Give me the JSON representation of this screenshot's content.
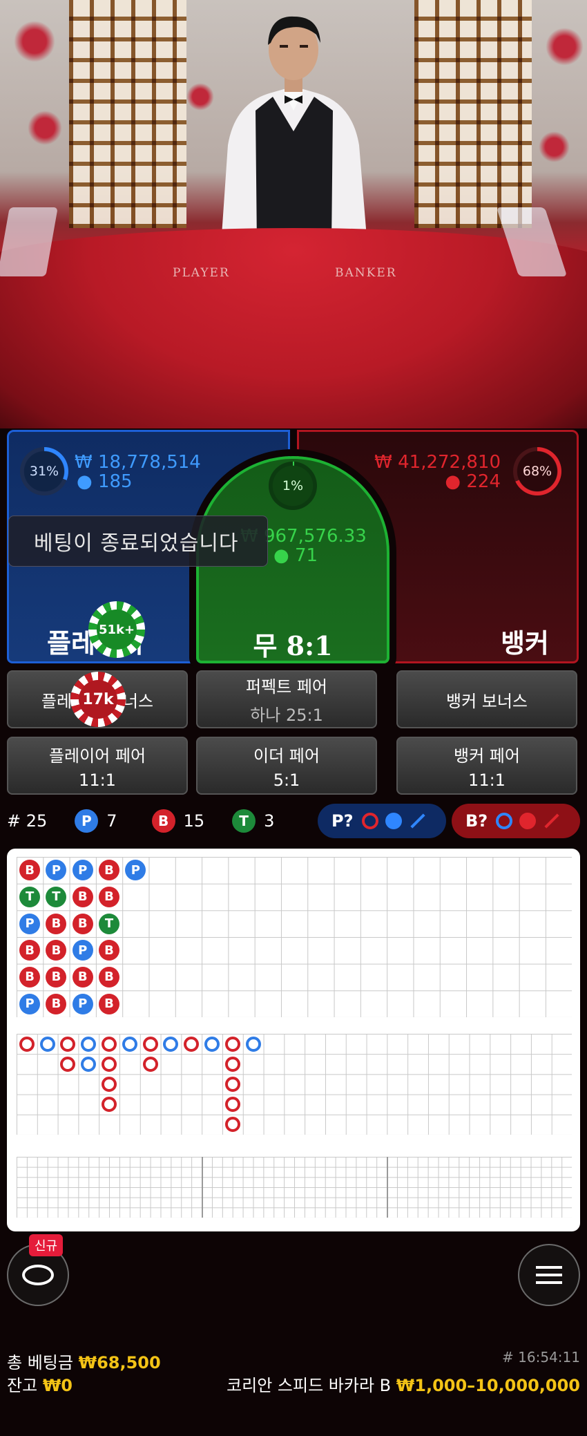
{
  "video": {
    "felt_player": "PLAYER",
    "felt_banker": "BANKER"
  },
  "player": {
    "percent": "31%",
    "amount": "₩ 18,778,514",
    "count": "185",
    "label": "플레이어"
  },
  "banker": {
    "percent": "68%",
    "amount": "₩ 41,272,810",
    "count": "224",
    "label": "뱅커"
  },
  "tie": {
    "percent": "1%",
    "amount": "₩ 967,576.33",
    "count": "71",
    "label": "무 8:1"
  },
  "toast": "베팅이 종료되었습니다",
  "chips": {
    "main_chip": "51k+",
    "bonus_chip": "17k"
  },
  "side_bets": {
    "player_bonus": "플레이어 보너스",
    "perfect_pair": "퍼펙트 페어",
    "perfect_pair_odds": "하나 25:1",
    "banker_bonus": "뱅커 보너스",
    "player_pair": "플레이어 페어",
    "player_pair_odds": "11:1",
    "either_pair": "이더 페어",
    "either_pair_odds": "5:1",
    "banker_pair": "뱅커 페어",
    "banker_pair_odds": "11:1"
  },
  "stats": {
    "round_label": "# 25",
    "p_letter": "P",
    "p_count": "7",
    "b_letter": "B",
    "b_count": "15",
    "t_letter": "T",
    "t_count": "3",
    "player_predict": "P?",
    "banker_predict": "B?"
  },
  "roadmap": {
    "bead_road": [
      [
        "B",
        "T",
        "P",
        "B",
        "B",
        "P"
      ],
      [
        "P",
        "T",
        "B",
        "B",
        "B",
        "B"
      ],
      [
        "P",
        "B",
        "B",
        "P",
        "B",
        "P"
      ],
      [
        "B",
        "B",
        "T",
        "B",
        "B",
        "B"
      ],
      [
        "P"
      ]
    ],
    "colors": {
      "player": "#2f7ce6",
      "banker": "#d3222a",
      "tie": "#1d8a3a"
    }
  },
  "bottom": {
    "new_badge": "신규",
    "total_bet_label": "총 베팅금",
    "total_bet_value": "₩68,500",
    "balance_label": "잔고",
    "balance_value": "₩0",
    "time": "# 16:54:11",
    "table_name": "코리안 스피드 바카라 B",
    "limits": "₩1,000–10,000,000"
  },
  "icons": {
    "chat": "chat-bubble-icon",
    "menu": "hamburger-menu-icon"
  }
}
